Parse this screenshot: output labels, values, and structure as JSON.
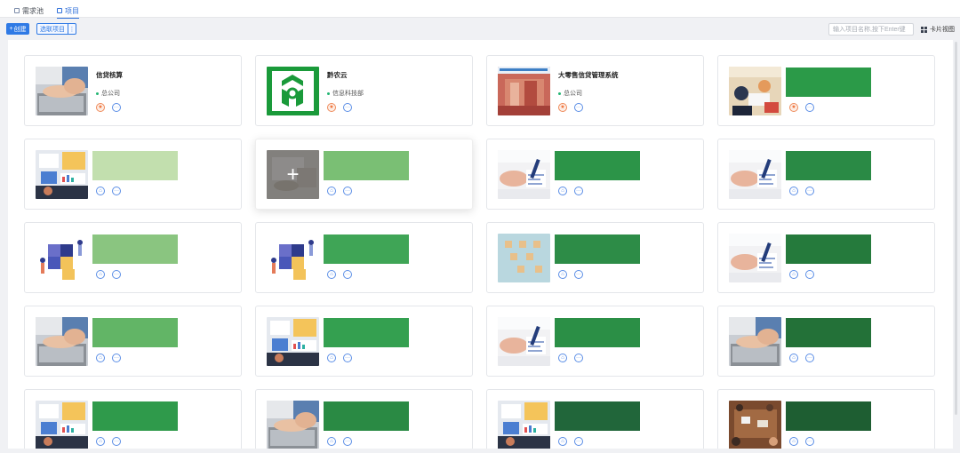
{
  "tabs": [
    {
      "label": "需求池",
      "icon": "document-icon",
      "active": false
    },
    {
      "label": "项目",
      "icon": "edit-icon",
      "active": true
    }
  ],
  "toolbar": {
    "new_label": "创建",
    "filter_label": "选联项目",
    "filter_more": "⋮",
    "search_placeholder": "输入项目名称,按下Enter键",
    "view_label": "卡片视图"
  },
  "colors": {
    "accent": "#2f7ae5",
    "green_dot": "#22b573",
    "favorite": "#ef6b2f"
  },
  "cards": [
    {
      "title": "信贷核算",
      "org": "总公司",
      "thumb": "typing",
      "favorite": true
    },
    {
      "title": "黔农云",
      "org": "信息科技部",
      "thumb": "logo",
      "favorite": true
    },
    {
      "title": "大零售信贷管理系统",
      "org": "总公司",
      "thumb": "banner",
      "favorite": true
    },
    {
      "title": "",
      "org": "",
      "thumb": "office",
      "favorite": true,
      "redacted": "#2b9a48"
    },
    {
      "title": "",
      "org": "",
      "thumb": "charts",
      "favorite": false,
      "redacted": "#c2dfae"
    },
    {
      "title": "",
      "org": "",
      "thumb": "desk-plus",
      "favorite": false,
      "hover": true,
      "redacted": "#7abf74"
    },
    {
      "title": "",
      "org": "",
      "thumb": "handshake",
      "favorite": false,
      "redacted": "#2c9448"
    },
    {
      "title": "",
      "org": "",
      "thumb": "handshake",
      "favorite": false,
      "redacted": "#2a8a45"
    },
    {
      "title": "",
      "org": "",
      "thumb": "puzzle",
      "favorite": false,
      "redacted": "#8ac580"
    },
    {
      "title": "",
      "org": "",
      "thumb": "puzzle",
      "favorite": false,
      "redacted": "#3fa556"
    },
    {
      "title": "",
      "org": "",
      "thumb": "icons",
      "favorite": false,
      "redacted": "#2d8c47"
    },
    {
      "title": "",
      "org": "",
      "thumb": "handshake",
      "favorite": false,
      "redacted": "#257a3c"
    },
    {
      "title": "",
      "org": "",
      "thumb": "typing",
      "favorite": false,
      "redacted": "#62b566"
    },
    {
      "title": "",
      "org": "",
      "thumb": "charts",
      "favorite": false,
      "redacted": "#34a050"
    },
    {
      "title": "",
      "org": "",
      "thumb": "handshake",
      "favorite": false,
      "redacted": "#2b8f46"
    },
    {
      "title": "",
      "org": "",
      "thumb": "typing",
      "favorite": false,
      "redacted": "#237138"
    },
    {
      "title": "",
      "org": "",
      "thumb": "charts",
      "favorite": false,
      "redacted": "#2f9a4b"
    },
    {
      "title": "",
      "org": "",
      "thumb": "typing",
      "favorite": false,
      "redacted": "#2a8a44"
    },
    {
      "title": "",
      "org": "",
      "thumb": "charts",
      "favorite": false,
      "redacted": "#21663a"
    },
    {
      "title": "",
      "org": "",
      "thumb": "meeting",
      "favorite": false,
      "redacted": "#1e5e32"
    }
  ]
}
